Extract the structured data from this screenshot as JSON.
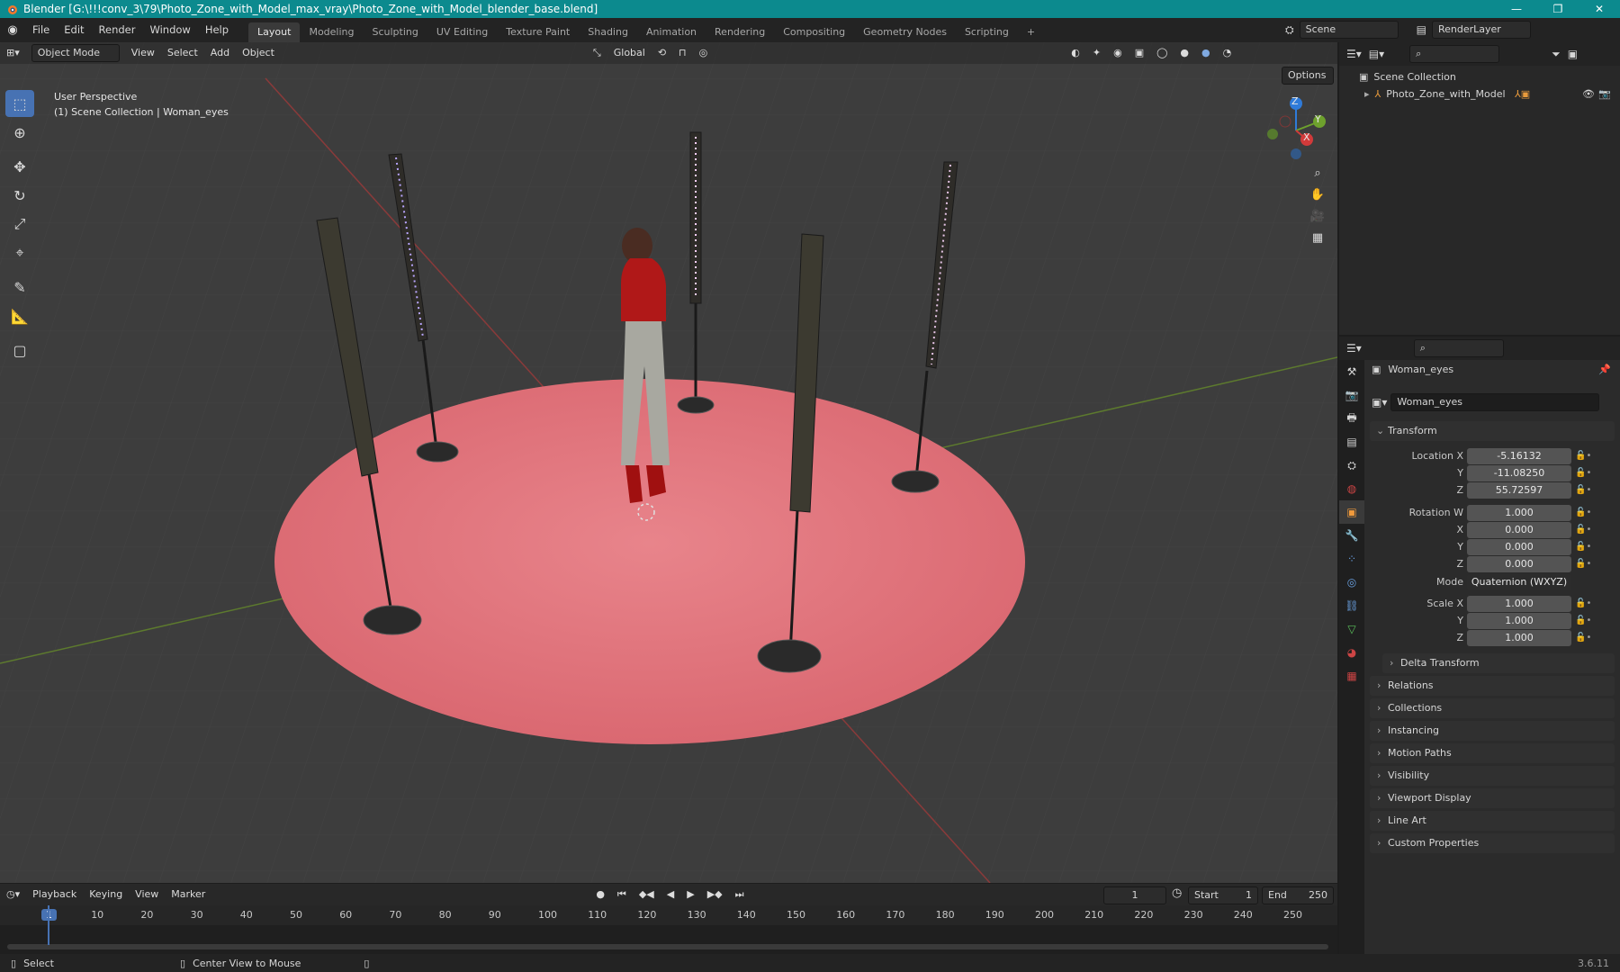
{
  "window": {
    "title": "Blender [G:\\!!!conv_3\\79\\Photo_Zone_with_Model_max_vray\\Photo_Zone_with_Model_blender_base.blend]",
    "minimize": "—",
    "maximize": "❐",
    "close": "✕"
  },
  "menu": [
    "File",
    "Edit",
    "Render",
    "Window",
    "Help"
  ],
  "workspaces": [
    "Layout",
    "Modeling",
    "Sculpting",
    "UV Editing",
    "Texture Paint",
    "Shading",
    "Animation",
    "Rendering",
    "Compositing",
    "Geometry Nodes",
    "Scripting"
  ],
  "add_workspace": "+",
  "scene": {
    "name": "Scene",
    "render_layer": "RenderLayer"
  },
  "viewport": {
    "mode": "Object Mode",
    "menus": [
      "View",
      "Select",
      "Add",
      "Object"
    ],
    "orientation": "Global",
    "options": "Options",
    "perspective": "User Perspective",
    "collection_info": "(1) Scene Collection | Woman_eyes",
    "axes": {
      "x": "X",
      "y": "Y",
      "z": "Z"
    }
  },
  "outliner": {
    "root": "Scene Collection",
    "items": [
      "Photo_Zone_with_Model"
    ]
  },
  "properties": {
    "object_name": "Woman_eyes",
    "data_name": "Woman_eyes",
    "transform_title": "Transform",
    "location": {
      "label": "Location X",
      "x": "-5.16132",
      "y": "-11.08250",
      "z": "55.72597"
    },
    "rotation": {
      "label": "Rotation W",
      "w": "1.000",
      "x": "0.000",
      "y": "0.000",
      "z": "0.000"
    },
    "mode_label": "Mode",
    "mode_value": "Quaternion (WXYZ)",
    "scale": {
      "label": "Scale X",
      "x": "1.000",
      "y": "1.000",
      "z": "1.000"
    },
    "axis_labels": {
      "y": "Y",
      "z": "Z",
      "x": "X"
    },
    "delta": "Delta Transform",
    "panels": [
      "Relations",
      "Collections",
      "Instancing",
      "Motion Paths",
      "Visibility",
      "Viewport Display",
      "Line Art",
      "Custom Properties"
    ]
  },
  "timeline": {
    "menus": [
      "Playback",
      "Keying",
      "View",
      "Marker"
    ],
    "current_frame": "1",
    "start_label": "Start",
    "start": "1",
    "end_label": "End",
    "end": "250",
    "ticks": [
      "1",
      "10",
      "20",
      "30",
      "40",
      "50",
      "60",
      "70",
      "80",
      "90",
      "100",
      "110",
      "120",
      "130",
      "140",
      "150",
      "160",
      "170",
      "180",
      "190",
      "200",
      "210",
      "220",
      "230",
      "240",
      "250"
    ]
  },
  "status": {
    "select": "Select",
    "center_view": "Center View to Mouse",
    "version": "3.6.11"
  },
  "colors": {
    "titlebar": "#0c8a8e",
    "accent": "#4772b3",
    "rug": "#e0727a",
    "viewport_bg": "#3d3d3d"
  }
}
